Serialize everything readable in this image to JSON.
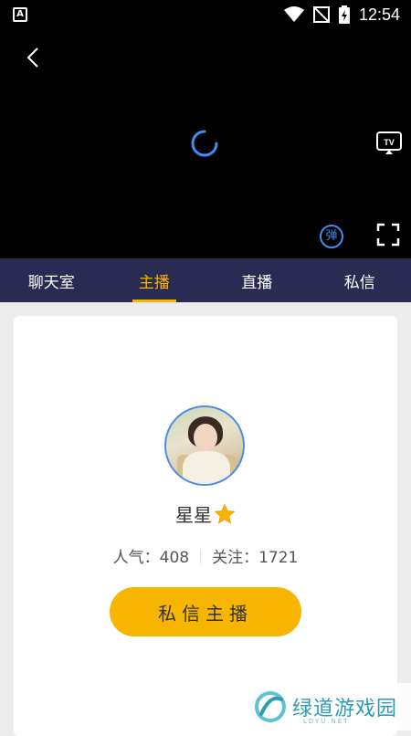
{
  "status_bar": {
    "left_icon": "A",
    "time": "12:54",
    "icons": [
      "wifi-icon",
      "no-signal-icon",
      "battery-icon"
    ]
  },
  "player": {
    "tv_label": "TV",
    "danmu_label": "弹"
  },
  "tabs": [
    {
      "label": "聊天室",
      "active": false
    },
    {
      "label": "主播",
      "active": true
    },
    {
      "label": "直播",
      "active": false
    },
    {
      "label": "私信",
      "active": false
    }
  ],
  "anchor": {
    "name": "星星",
    "popularity_label": "人气：408",
    "following_label": "关注：1721",
    "message_button": "私信主播"
  },
  "watermark": {
    "text": "绿道游戏园",
    "sub": "LDYU.NET"
  },
  "colors": {
    "accent": "#f7b500",
    "tabbar": "#2a2b52",
    "spinner": "#3d8ff0"
  }
}
